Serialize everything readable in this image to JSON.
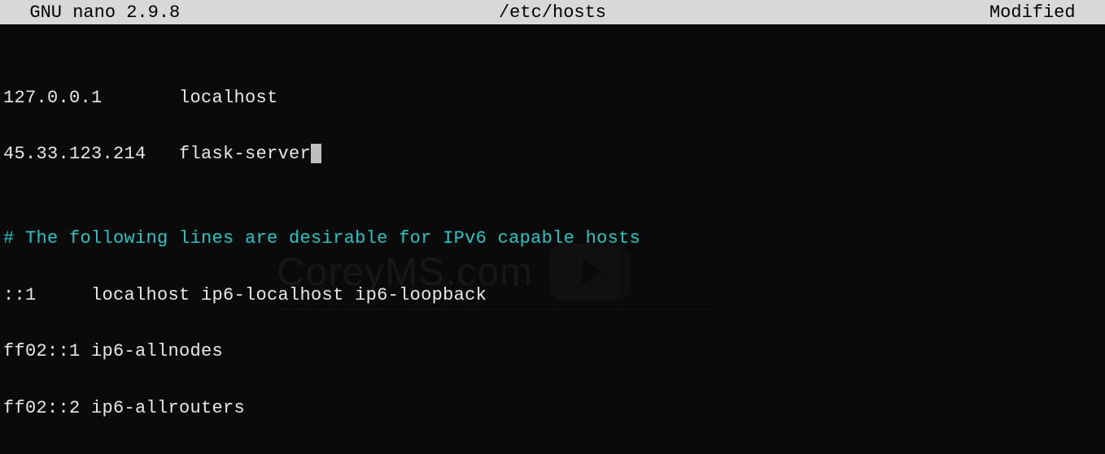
{
  "titlebar": {
    "left": "  GNU nano 2.9.8",
    "center": "/etc/hosts",
    "right": "Modified  "
  },
  "lines": {
    "blank": "",
    "l1": "127.0.0.1       localhost",
    "l2a": "45.33.123.214   flask-server",
    "comment": "# The following lines are desirable for IPv6 capable hosts",
    "l4": "::1     localhost ip6-localhost ip6-loopback",
    "l5": "ff02::1 ip6-allnodes",
    "l6": "ff02::2 ip6-allrouters"
  },
  "watermark": {
    "text": "CoreyMS.com"
  }
}
